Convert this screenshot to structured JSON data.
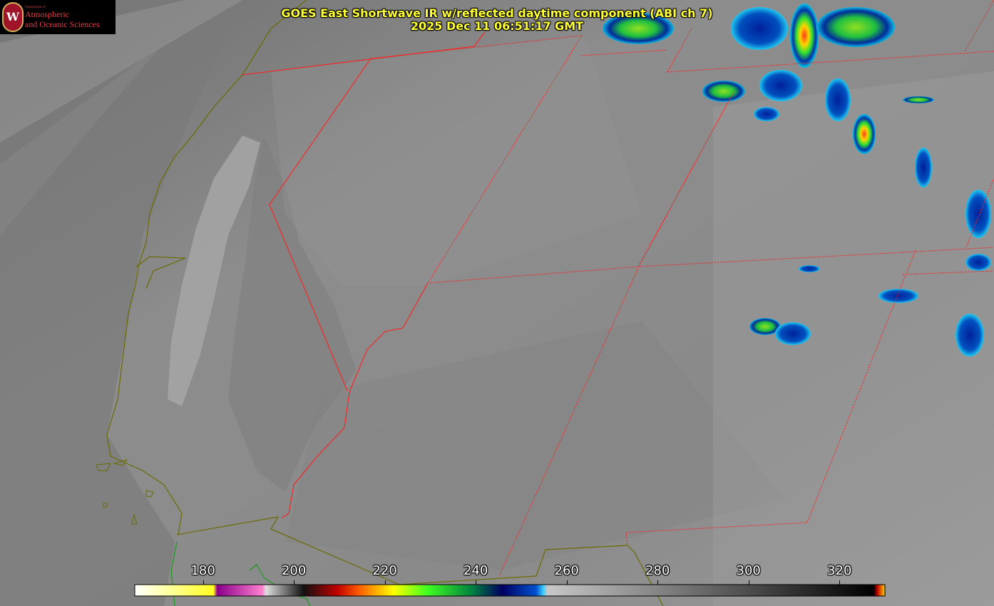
{
  "title": {
    "line1": "GOES East Shortwave IR w/reflected daytime component (ABI ch 7)",
    "line2": "2025 Dec 11 06:51:17 GMT"
  },
  "logo": {
    "department": "Department of",
    "line1": "Atmospheric",
    "line2": "and Oceanic Sciences",
    "seal_letter": "W"
  },
  "colorbar": {
    "min": 165,
    "max": 330,
    "ticks": [
      "180",
      "200",
      "220",
      "240",
      "260",
      "280",
      "300",
      "320"
    ],
    "tick_values": [
      180,
      200,
      220,
      240,
      260,
      280,
      300,
      320
    ]
  },
  "colors": {
    "title": "#ffff33",
    "state_border": "#ff2020",
    "coastline": "#6b6b00",
    "coastline_south": "#1a9a1a"
  }
}
